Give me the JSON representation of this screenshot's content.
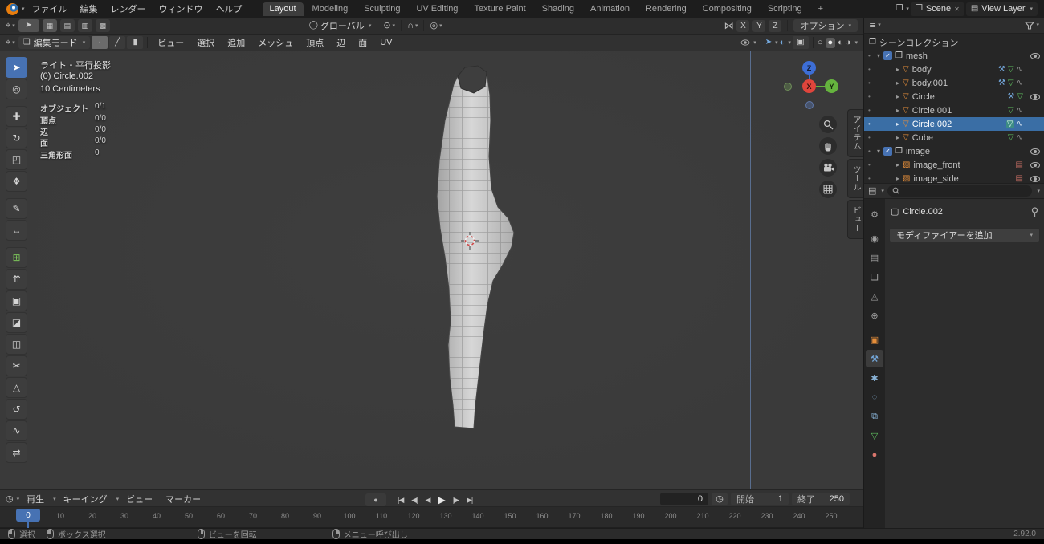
{
  "colors": {
    "accent": "#4772b3",
    "selection_blue": "#3a6ea5",
    "object_orange": "#e58e3a",
    "data_green": "#5fbf5f",
    "modifier_blue": "#74a8dc",
    "axis_x": "#e0453c",
    "axis_y": "#65b33e",
    "axis_z": "#3d6ed6"
  },
  "icons": {
    "chevron": "▾",
    "editor_viewport": "⌖",
    "active_tool": "➤",
    "grid_a": "▦",
    "grid_b": "▤",
    "grid_c": "▥",
    "grid_d": "▩",
    "orientation": "◯",
    "pivot": "⊙",
    "magnet": "∩",
    "proportional": "◎",
    "mirror": "⋈",
    "edit_mode": "❏",
    "vertex_mode": "∙",
    "edge_mode": "╱",
    "face_mode": "▮",
    "gizmo_toggle": "➤",
    "overlays": "◐",
    "xray": "▣",
    "sphere_wireframe": "○",
    "sphere_solid": "●",
    "sphere_material": "◐",
    "sphere_rendered": "◑",
    "outliner_editor": "≣",
    "properties_editor": "▤",
    "collection": "❒",
    "mesh_object": "▽",
    "mesh_data": "▽",
    "modifier": "⚒",
    "image_object": "▧",
    "image_data": "▤",
    "disc_open": "▾",
    "disc_closed": "▸",
    "dot": "•",
    "check": "✓",
    "wave": "∿",
    "timeline_editor": "◷",
    "clock": "◷",
    "record": "●",
    "close": "✕",
    "object_crumb": "▢"
  },
  "topbar": {
    "menus": [
      "ファイル",
      "編集",
      "レンダー",
      "ウィンドウ",
      "ヘルプ"
    ],
    "workspaces": [
      "Layout",
      "Modeling",
      "Sculpting",
      "UV Editing",
      "Texture Paint",
      "Shading",
      "Animation",
      "Rendering",
      "Compositing",
      "Scripting"
    ],
    "active_workspace": "Layout",
    "add_tab": "+",
    "scene": "Scene",
    "view_layer": "View Layer"
  },
  "tool_settings": {
    "orientation": "グローバル",
    "axes": [
      "X",
      "Y",
      "Z"
    ],
    "options": "オプション"
  },
  "viewport_header": {
    "mode": "編集モード",
    "menus": [
      "ビュー",
      "選択",
      "追加",
      "メッシュ",
      "頂点",
      "辺",
      "面",
      "UV"
    ]
  },
  "left_toolbar": {
    "tools": [
      {
        "name": "tweak",
        "glyph": "➤"
      },
      {
        "name": "cursor",
        "glyph": "◎"
      },
      {
        "name": "move",
        "glyph": "✚"
      },
      {
        "name": "rotate",
        "glyph": "↻"
      },
      {
        "name": "scale",
        "glyph": "◰"
      },
      {
        "name": "transform",
        "glyph": "❖"
      },
      {
        "name": "annotate",
        "glyph": "✎"
      },
      {
        "name": "measure",
        "glyph": "↔"
      },
      {
        "name": "add-cube",
        "glyph": "⊞"
      },
      {
        "name": "extrude-region",
        "glyph": "⇈"
      },
      {
        "name": "inset-faces",
        "glyph": "▣"
      },
      {
        "name": "bevel",
        "glyph": "◪"
      },
      {
        "name": "loop-cut",
        "glyph": "◫"
      },
      {
        "name": "knife",
        "glyph": "✂"
      },
      {
        "name": "poly-build",
        "glyph": "△"
      },
      {
        "name": "spin",
        "glyph": "↺"
      },
      {
        "name": "smooth",
        "glyph": "∿"
      },
      {
        "name": "edge-slide",
        "glyph": "⇄"
      }
    ]
  },
  "viewport": {
    "overlay": {
      "view_label": "ライト・平行投影",
      "object_label": "(0) Circle.002",
      "unit_label": "10 Centimeters",
      "stats": [
        {
          "label": "オブジェクト",
          "value": "0/1"
        },
        {
          "label": "頂点",
          "value": "0/0"
        },
        {
          "label": "辺",
          "value": "0/0"
        },
        {
          "label": "面",
          "value": "0/0"
        },
        {
          "label": "三角形面",
          "value": "0"
        }
      ]
    },
    "gizmo": {
      "x": "X",
      "y": "Y",
      "z": "Z"
    },
    "sidebar_tabs": [
      "アイテム",
      "ツール",
      "ビュー"
    ]
  },
  "outliner": {
    "root": "シーンコレクション",
    "mesh_collection": "mesh",
    "objects": [
      "body",
      "body.001",
      "Circle",
      "Circle.001",
      "Circle.002",
      "Cube"
    ],
    "image_collection": "image",
    "images": [
      "image_front",
      "image_side"
    ]
  },
  "properties": {
    "object_name": "Circle.002",
    "add_modifier": "モディファイアーを追加",
    "tabs": [
      {
        "name": "tool",
        "glyph": "⚙"
      },
      {
        "name": "render",
        "glyph": "◉"
      },
      {
        "name": "output",
        "glyph": "▤"
      },
      {
        "name": "view-layer",
        "glyph": "❏"
      },
      {
        "name": "scene",
        "glyph": "◬"
      },
      {
        "name": "world",
        "glyph": "⊕"
      },
      {
        "name": "object",
        "glyph": "▣"
      },
      {
        "name": "modifiers",
        "glyph": "⚒"
      },
      {
        "name": "particles",
        "glyph": "✱"
      },
      {
        "name": "physics",
        "glyph": "◌"
      },
      {
        "name": "constraints",
        "glyph": "⧉"
      },
      {
        "name": "object-data",
        "glyph": "▽"
      },
      {
        "name": "material",
        "glyph": "●"
      }
    ]
  },
  "timeline": {
    "menus": [
      "再生",
      "キーイング",
      "ビュー",
      "マーカー"
    ],
    "playback": [
      "|◀",
      "◀|",
      "◀",
      "▶",
      "|▶",
      "▶|"
    ],
    "current_frame": "0",
    "start_label": "開始",
    "start_value": "1",
    "end_label": "終了",
    "end_value": "250",
    "playhead": "0",
    "ticks": [
      "0",
      "10",
      "20",
      "30",
      "40",
      "50",
      "60",
      "70",
      "80",
      "90",
      "100",
      "110",
      "120",
      "130",
      "140",
      "150",
      "160",
      "170",
      "180",
      "190",
      "200",
      "210",
      "220",
      "230",
      "240",
      "250"
    ]
  },
  "status_bar": {
    "select": "選択",
    "box_select": "ボックス選択",
    "rotate_view": "ビューを回転",
    "call_menu": "メニュー呼び出し",
    "version": "2.92.0"
  }
}
